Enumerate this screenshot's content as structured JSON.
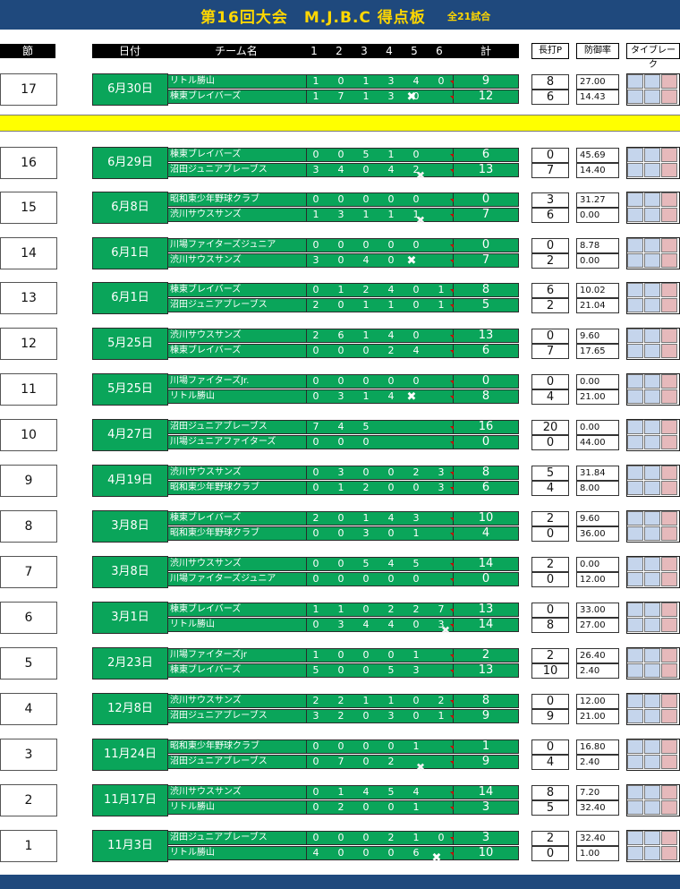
{
  "title": "第16回大会　M.J.B.C 得点板",
  "subtitle": "全21試合",
  "headers": {
    "setsu": "節",
    "date": "日付",
    "team": "チーム名",
    "innings": [
      "1",
      "2",
      "3",
      "4",
      "5",
      "6"
    ],
    "total": "計",
    "homerun": "長打P",
    "era": "防御率",
    "tiebreak": "タイブレーク"
  },
  "colors": {
    "banner": "#1f497d",
    "title": "#ffd700",
    "score_bg": "#0aa55a",
    "highlight": "#ffff00",
    "tb_blue": "#c5d5ec",
    "tb_pink": "#e6b9bb"
  },
  "icons": {
    "win_mark": "x-mark-icon"
  },
  "matches": [
    {
      "setsu": "17",
      "date": "6月30日",
      "teams": [
        {
          "name": "リトル勝山",
          "innings": [
            "1",
            "0",
            "1",
            "3",
            "4",
            "0"
          ],
          "total": "9",
          "hr": "8",
          "era": "27.00"
        },
        {
          "name": "棟東ブレイバーズ",
          "innings": [
            "1",
            "7",
            "1",
            "3",
            "0",
            ""
          ],
          "total": "12",
          "hr": "6",
          "era": "14.43",
          "x": true
        }
      ]
    },
    {
      "setsu": "16",
      "date": "6月29日",
      "teams": [
        {
          "name": "棟東ブレイバーズ",
          "innings": [
            "0",
            "0",
            "5",
            "1",
            "0",
            ""
          ],
          "total": "6",
          "hr": "0",
          "era": "45.69"
        },
        {
          "name": "沼田ジュニアブレーブス",
          "innings": [
            "3",
            "4",
            "0",
            "4",
            "2",
            ""
          ],
          "total": "13",
          "hr": "7",
          "era": "14.40",
          "xs": true
        }
      ]
    },
    {
      "setsu": "15",
      "date": "6月8日",
      "teams": [
        {
          "name": "昭和東少年野球クラブ",
          "innings": [
            "0",
            "0",
            "0",
            "0",
            "0",
            ""
          ],
          "total": "0",
          "hr": "3",
          "era": "31.27"
        },
        {
          "name": "渋川サウスサンズ",
          "innings": [
            "1",
            "3",
            "1",
            "1",
            "1",
            ""
          ],
          "total": "7",
          "hr": "6",
          "era": "0.00",
          "xs": true
        }
      ]
    },
    {
      "setsu": "14",
      "date": "6月1日",
      "teams": [
        {
          "name": "川場ファイターズジュニア",
          "innings": [
            "0",
            "0",
            "0",
            "0",
            "0",
            ""
          ],
          "total": "0",
          "hr": "0",
          "era": "8.78"
        },
        {
          "name": "渋川サウスサンズ",
          "innings": [
            "3",
            "0",
            "4",
            "0",
            "",
            ""
          ],
          "total": "7",
          "hr": "2",
          "era": "0.00",
          "x": true
        }
      ]
    },
    {
      "setsu": "13",
      "date": "6月1日",
      "teams": [
        {
          "name": "棟東ブレイバーズ",
          "innings": [
            "0",
            "1",
            "2",
            "4",
            "0",
            "1"
          ],
          "total": "8",
          "hr": "6",
          "era": "10.02"
        },
        {
          "name": "沼田ジュニアブレーブス",
          "innings": [
            "2",
            "0",
            "1",
            "1",
            "0",
            "1"
          ],
          "total": "5",
          "hr": "2",
          "era": "21.04"
        }
      ]
    },
    {
      "setsu": "12",
      "date": "5月25日",
      "teams": [
        {
          "name": "渋川サウスサンズ",
          "innings": [
            "2",
            "6",
            "1",
            "4",
            "0",
            ""
          ],
          "total": "13",
          "hr": "0",
          "era": "9.60"
        },
        {
          "name": "棟東ブレイバーズ",
          "innings": [
            "0",
            "0",
            "0",
            "2",
            "4",
            ""
          ],
          "total": "6",
          "hr": "7",
          "era": "17.65"
        }
      ]
    },
    {
      "setsu": "11",
      "date": "5月25日",
      "teams": [
        {
          "name": "川場ファイターズJr.",
          "innings": [
            "0",
            "0",
            "0",
            "0",
            "0",
            ""
          ],
          "total": "0",
          "hr": "0",
          "era": "0.00"
        },
        {
          "name": "リトル勝山",
          "innings": [
            "0",
            "3",
            "1",
            "4",
            "",
            ""
          ],
          "total": "8",
          "hr": "4",
          "era": "21.00",
          "x": true
        }
      ]
    },
    {
      "setsu": "10",
      "date": "4月27日",
      "teams": [
        {
          "name": "沼田ジュニアブレーブス",
          "innings": [
            "7",
            "4",
            "5",
            "",
            "",
            ""
          ],
          "total": "16",
          "hr": "20",
          "era": "0.00"
        },
        {
          "name": "川場ジュニアファイターズ",
          "innings": [
            "0",
            "0",
            "0",
            "",
            "",
            ""
          ],
          "total": "0",
          "hr": "0",
          "era": "44.00"
        }
      ]
    },
    {
      "setsu": "9",
      "date": "4月19日",
      "teams": [
        {
          "name": "渋川サウスサンズ",
          "innings": [
            "0",
            "3",
            "0",
            "0",
            "2",
            "3"
          ],
          "total": "8",
          "hr": "5",
          "era": "31.84"
        },
        {
          "name": "昭和東少年野球クラブ",
          "innings": [
            "0",
            "1",
            "2",
            "0",
            "0",
            "3"
          ],
          "total": "6",
          "hr": "4",
          "era": "8.00"
        }
      ]
    },
    {
      "setsu": "8",
      "date": "3月8日",
      "teams": [
        {
          "name": "棟東ブレイバーズ",
          "innings": [
            "2",
            "0",
            "1",
            "4",
            "3",
            ""
          ],
          "total": "10",
          "hr": "2",
          "era": "9.60"
        },
        {
          "name": "昭和東少年野球クラブ",
          "innings": [
            "0",
            "0",
            "3",
            "0",
            "1",
            ""
          ],
          "total": "4",
          "hr": "0",
          "era": "36.00"
        }
      ]
    },
    {
      "setsu": "7",
      "date": "3月8日",
      "teams": [
        {
          "name": "渋川サウスサンズ",
          "innings": [
            "0",
            "0",
            "5",
            "4",
            "5",
            ""
          ],
          "total": "14",
          "hr": "2",
          "era": "0.00"
        },
        {
          "name": "川場ファイターズジュニア",
          "innings": [
            "0",
            "0",
            "0",
            "0",
            "0",
            ""
          ],
          "total": "0",
          "hr": "0",
          "era": "12.00"
        }
      ]
    },
    {
      "setsu": "6",
      "date": "3月1日",
      "teams": [
        {
          "name": "棟東ブレイバーズ",
          "innings": [
            "1",
            "1",
            "0",
            "2",
            "2",
            "7"
          ],
          "total": "13",
          "hr": "0",
          "era": "33.00"
        },
        {
          "name": "リトル勝山",
          "innings": [
            "0",
            "3",
            "4",
            "4",
            "0",
            "3"
          ],
          "total": "14",
          "hr": "8",
          "era": "27.00",
          "xs6": true
        }
      ]
    },
    {
      "setsu": "5",
      "date": "2月23日",
      "teams": [
        {
          "name": "川場ファイターズjr",
          "innings": [
            "1",
            "0",
            "0",
            "0",
            "1",
            ""
          ],
          "total": "2",
          "hr": "2",
          "era": "26.40"
        },
        {
          "name": "棟東ブレイバーズ",
          "innings": [
            "5",
            "0",
            "0",
            "5",
            "3",
            ""
          ],
          "total": "13",
          "hr": "10",
          "era": "2.40"
        }
      ]
    },
    {
      "setsu": "4",
      "date": "12月8日",
      "teams": [
        {
          "name": "渋川サウスサンズ",
          "innings": [
            "2",
            "2",
            "1",
            "1",
            "0",
            "2"
          ],
          "total": "8",
          "hr": "0",
          "era": "12.00"
        },
        {
          "name": "沼田ジュニアブレーブス",
          "innings": [
            "3",
            "2",
            "0",
            "3",
            "0",
            "1"
          ],
          "total": "9",
          "hr": "9",
          "era": "21.00"
        }
      ]
    },
    {
      "setsu": "3",
      "date": "11月24日",
      "teams": [
        {
          "name": "昭和東少年野球クラブ",
          "innings": [
            "0",
            "0",
            "0",
            "0",
            "1",
            ""
          ],
          "total": "1",
          "hr": "0",
          "era": "16.80"
        },
        {
          "name": "沼田ジュニアブレーブス",
          "innings": [
            "0",
            "7",
            "0",
            "2",
            "",
            ""
          ],
          "total": "9",
          "hr": "4",
          "era": "2.40",
          "xs": true
        }
      ]
    },
    {
      "setsu": "2",
      "date": "11月17日",
      "teams": [
        {
          "name": "渋川サウスサンズ",
          "innings": [
            "0",
            "1",
            "4",
            "5",
            "4",
            ""
          ],
          "total": "14",
          "hr": "8",
          "era": "7.20"
        },
        {
          "name": "リトル勝山",
          "innings": [
            "0",
            "2",
            "0",
            "0",
            "1",
            ""
          ],
          "total": "3",
          "hr": "5",
          "era": "32.40"
        }
      ]
    },
    {
      "setsu": "1",
      "date": "11月3日",
      "teams": [
        {
          "name": "沼田ジュニアブレーブス",
          "innings": [
            "0",
            "0",
            "0",
            "2",
            "1",
            "0"
          ],
          "total": "3",
          "hr": "2",
          "era": "32.40"
        },
        {
          "name": "リトル勝山",
          "innings": [
            "4",
            "0",
            "0",
            "0",
            "6",
            ""
          ],
          "total": "10",
          "hr": "0",
          "era": "1.00",
          "x6": true
        }
      ]
    }
  ]
}
